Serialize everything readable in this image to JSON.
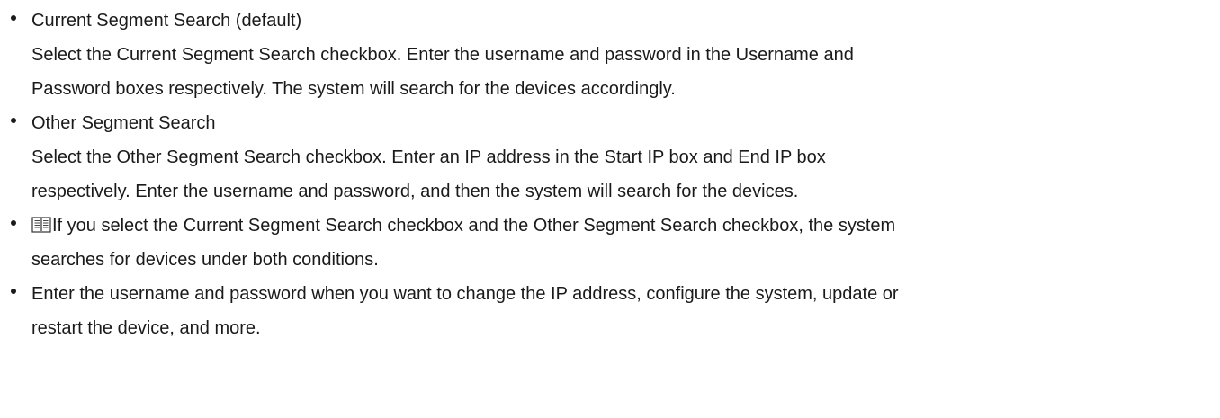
{
  "items": [
    {
      "title": "Current Segment Search (default)",
      "body_lines": [
        "Select the Current Segment Search checkbox. Enter the username and password in the Username and",
        "Password boxes respectively. The system will search for the devices accordingly."
      ]
    },
    {
      "title": "Other Segment Search",
      "body_lines": [
        "Select the Other Segment Search checkbox. Enter an IP address in the Start IP box and End IP box",
        "respectively. Enter the username and password, and then the system will search for the devices."
      ]
    },
    {
      "icon": "note-book-icon",
      "lines": [
        "If you select the Current Segment Search checkbox and the Other Segment Search checkbox, the system",
        "searches for devices under both conditions."
      ]
    },
    {
      "lines": [
        "Enter the username and password when you want to change the IP address, configure the system, update or",
        "restart the device, and more."
      ]
    }
  ]
}
